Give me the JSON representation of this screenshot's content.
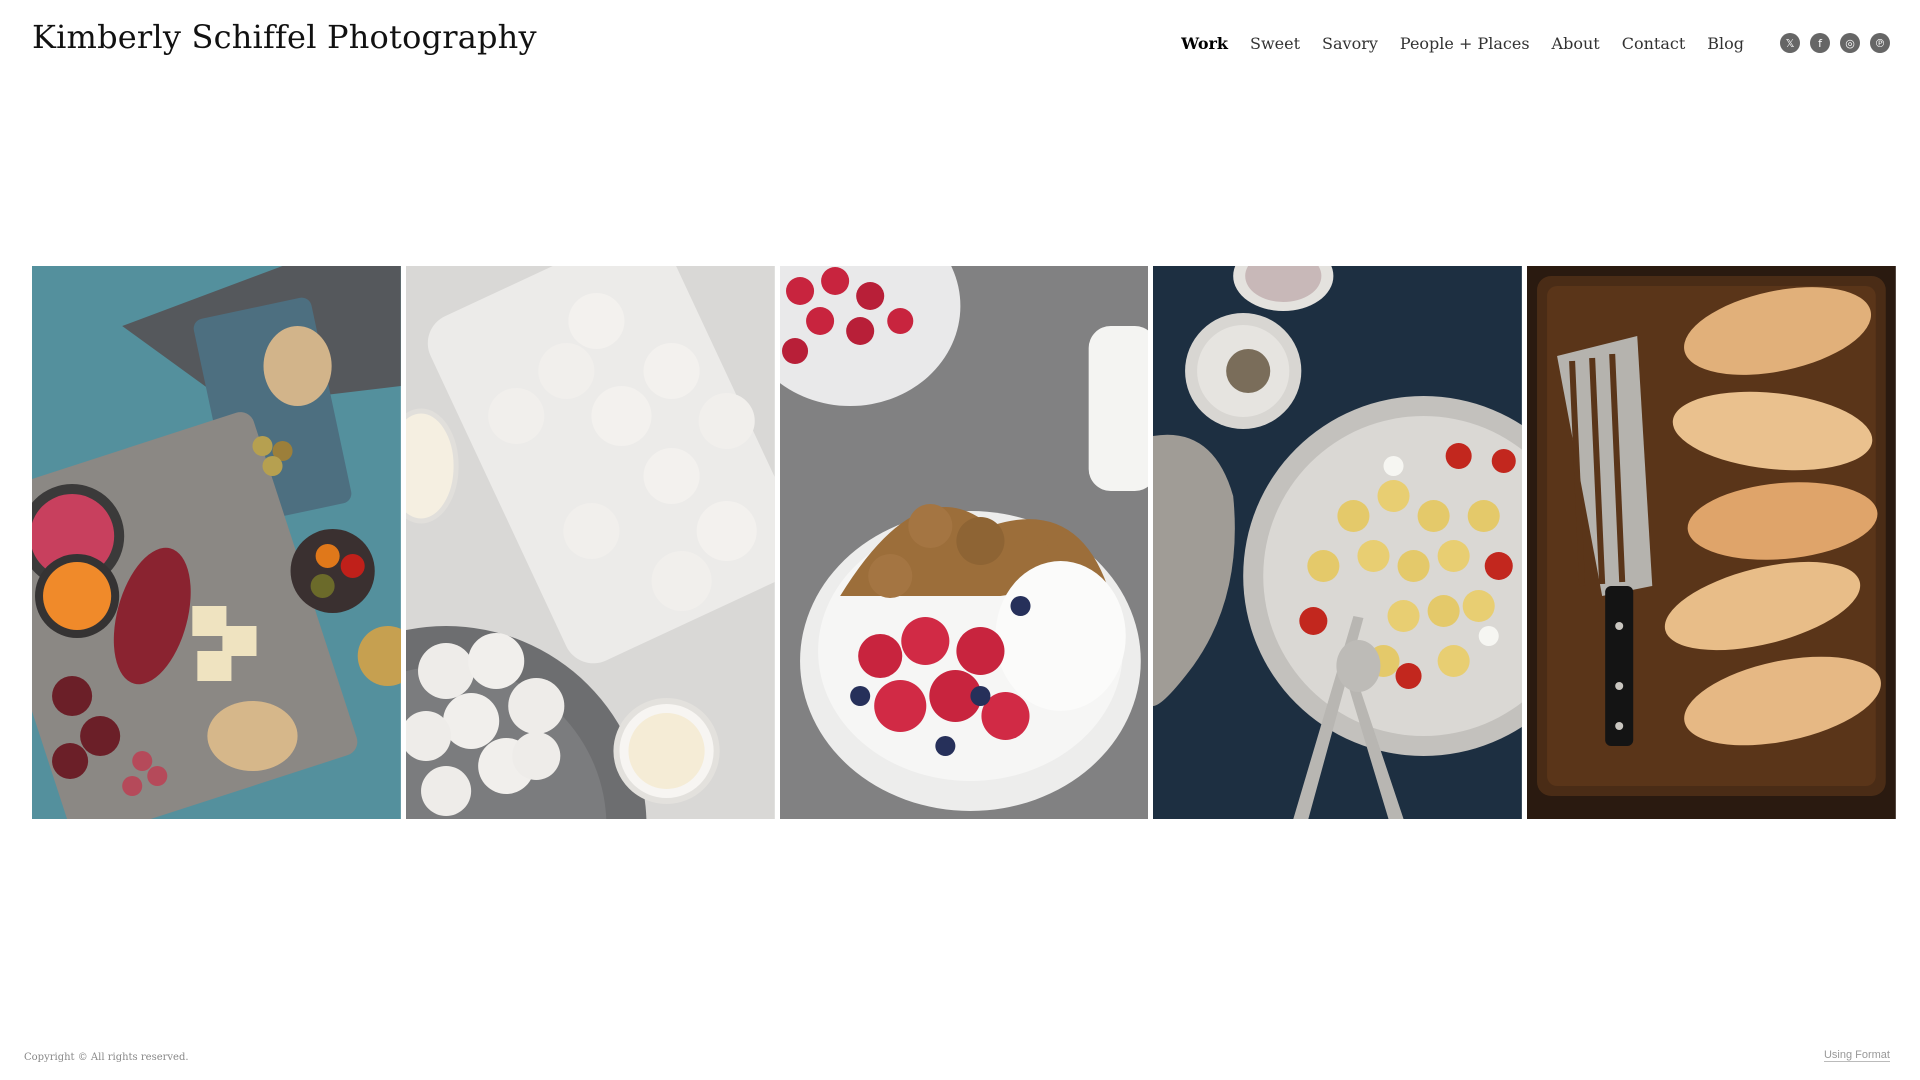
{
  "header": {
    "site_title": "Kimberly Schiffel Photography"
  },
  "nav": {
    "items": [
      {
        "label": "Work",
        "active": true
      },
      {
        "label": "Sweet",
        "active": false
      },
      {
        "label": "Savory",
        "active": false
      },
      {
        "label": "People + Places",
        "active": false
      },
      {
        "label": "About",
        "active": false
      },
      {
        "label": "Contact",
        "active": false
      },
      {
        "label": "Blog",
        "active": false
      }
    ],
    "social": [
      {
        "icon": "x-twitter-icon",
        "glyph": "𝕏"
      },
      {
        "icon": "facebook-icon",
        "glyph": "f"
      },
      {
        "icon": "instagram-icon",
        "glyph": "◎"
      },
      {
        "icon": "pinterest-icon",
        "glyph": "℗"
      }
    ]
  },
  "gallery": {
    "photos": [
      {
        "subject": "charcuterie-board"
      },
      {
        "subject": "snowball-cookies"
      },
      {
        "subject": "yogurt-granola-berries"
      },
      {
        "subject": "orecchiette-pasta"
      },
      {
        "subject": "fish-fillets-tray"
      }
    ]
  },
  "footer": {
    "copyright": "Copyright © All rights reserved.",
    "format_link": "Using Format"
  },
  "colors": {
    "social_icon_bg": "#666666",
    "text": "#1a1a1a"
  }
}
